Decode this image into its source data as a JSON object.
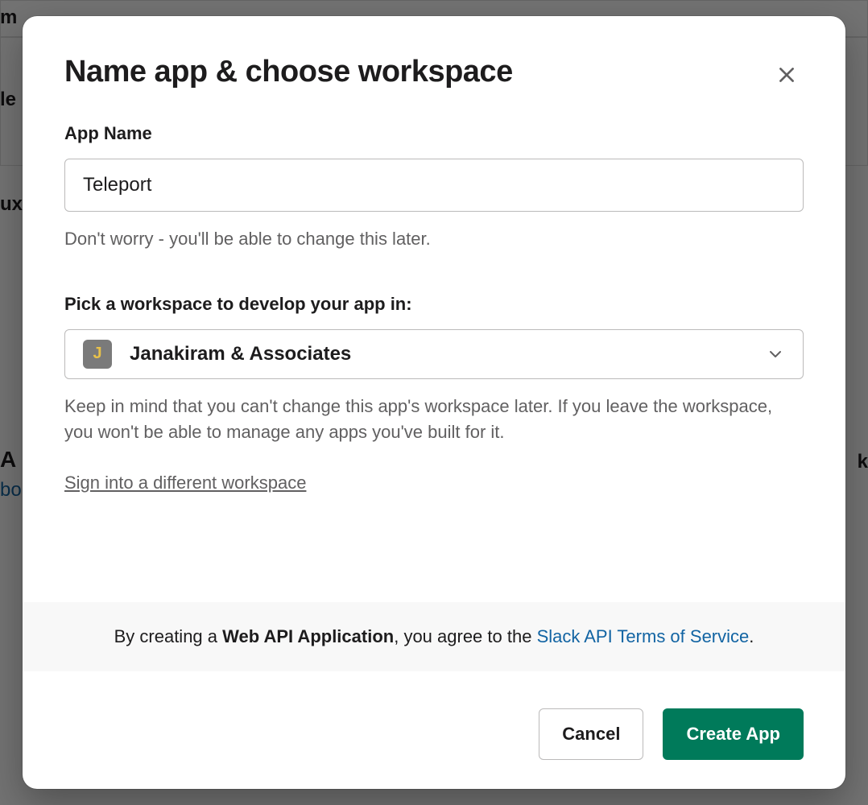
{
  "modal": {
    "title": "Name app & choose workspace",
    "appName": {
      "label": "App Name",
      "value": "Teleport",
      "placeholder": "",
      "helper": "Don't worry - you'll be able to change this later."
    },
    "workspace": {
      "label": "Pick a workspace to develop your app in:",
      "iconLetter": "J",
      "selected": "Janakiram & Associates",
      "helper": "Keep in mind that you can't change this app's workspace later. If you leave the workspace, you won't be able to manage any apps you've built for it.",
      "signinLink": "Sign into a different workspace"
    },
    "terms": {
      "prefix": "By creating a ",
      "bold": "Web API Application",
      "middle": ", you agree to the ",
      "linkText": "Slack API Terms of Service",
      "suffix": "."
    },
    "buttons": {
      "cancel": "Cancel",
      "create": "Create App"
    }
  },
  "backdrop": {
    "fragments": [
      "m",
      "le",
      "ux",
      "A",
      "bo",
      "k"
    ]
  }
}
